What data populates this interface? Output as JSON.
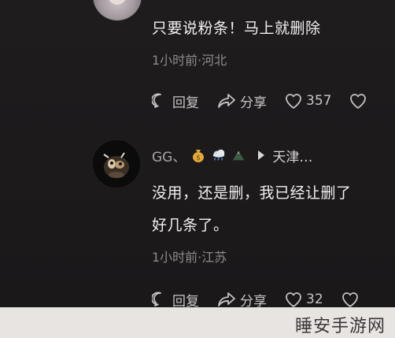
{
  "comment_1": {
    "text": "只要说粉条！马上就删除",
    "meta": "1小时前·河北",
    "actions": {
      "reply_label": "回复",
      "share_label": "分享",
      "like_count": "357"
    }
  },
  "comment_2": {
    "username": "GG、",
    "badges": [
      "money-bag-icon",
      "rain-cloud-icon",
      "mountain-icon"
    ],
    "reply_to": "天津…",
    "text_line1": "没用，还是删，我已经让删了",
    "text_line2": "好几条了。",
    "meta": "1小时前·江苏",
    "actions": {
      "reply_label": "回复",
      "share_label": "分享",
      "like_count": "32"
    }
  },
  "watermark": "睡安手游网",
  "colors": {
    "background": "#1b191a",
    "text": "#f4f2f0",
    "muted": "#8f8b8c",
    "action": "#c7c4c5",
    "watermark_bg": "#e8e4e1"
  }
}
